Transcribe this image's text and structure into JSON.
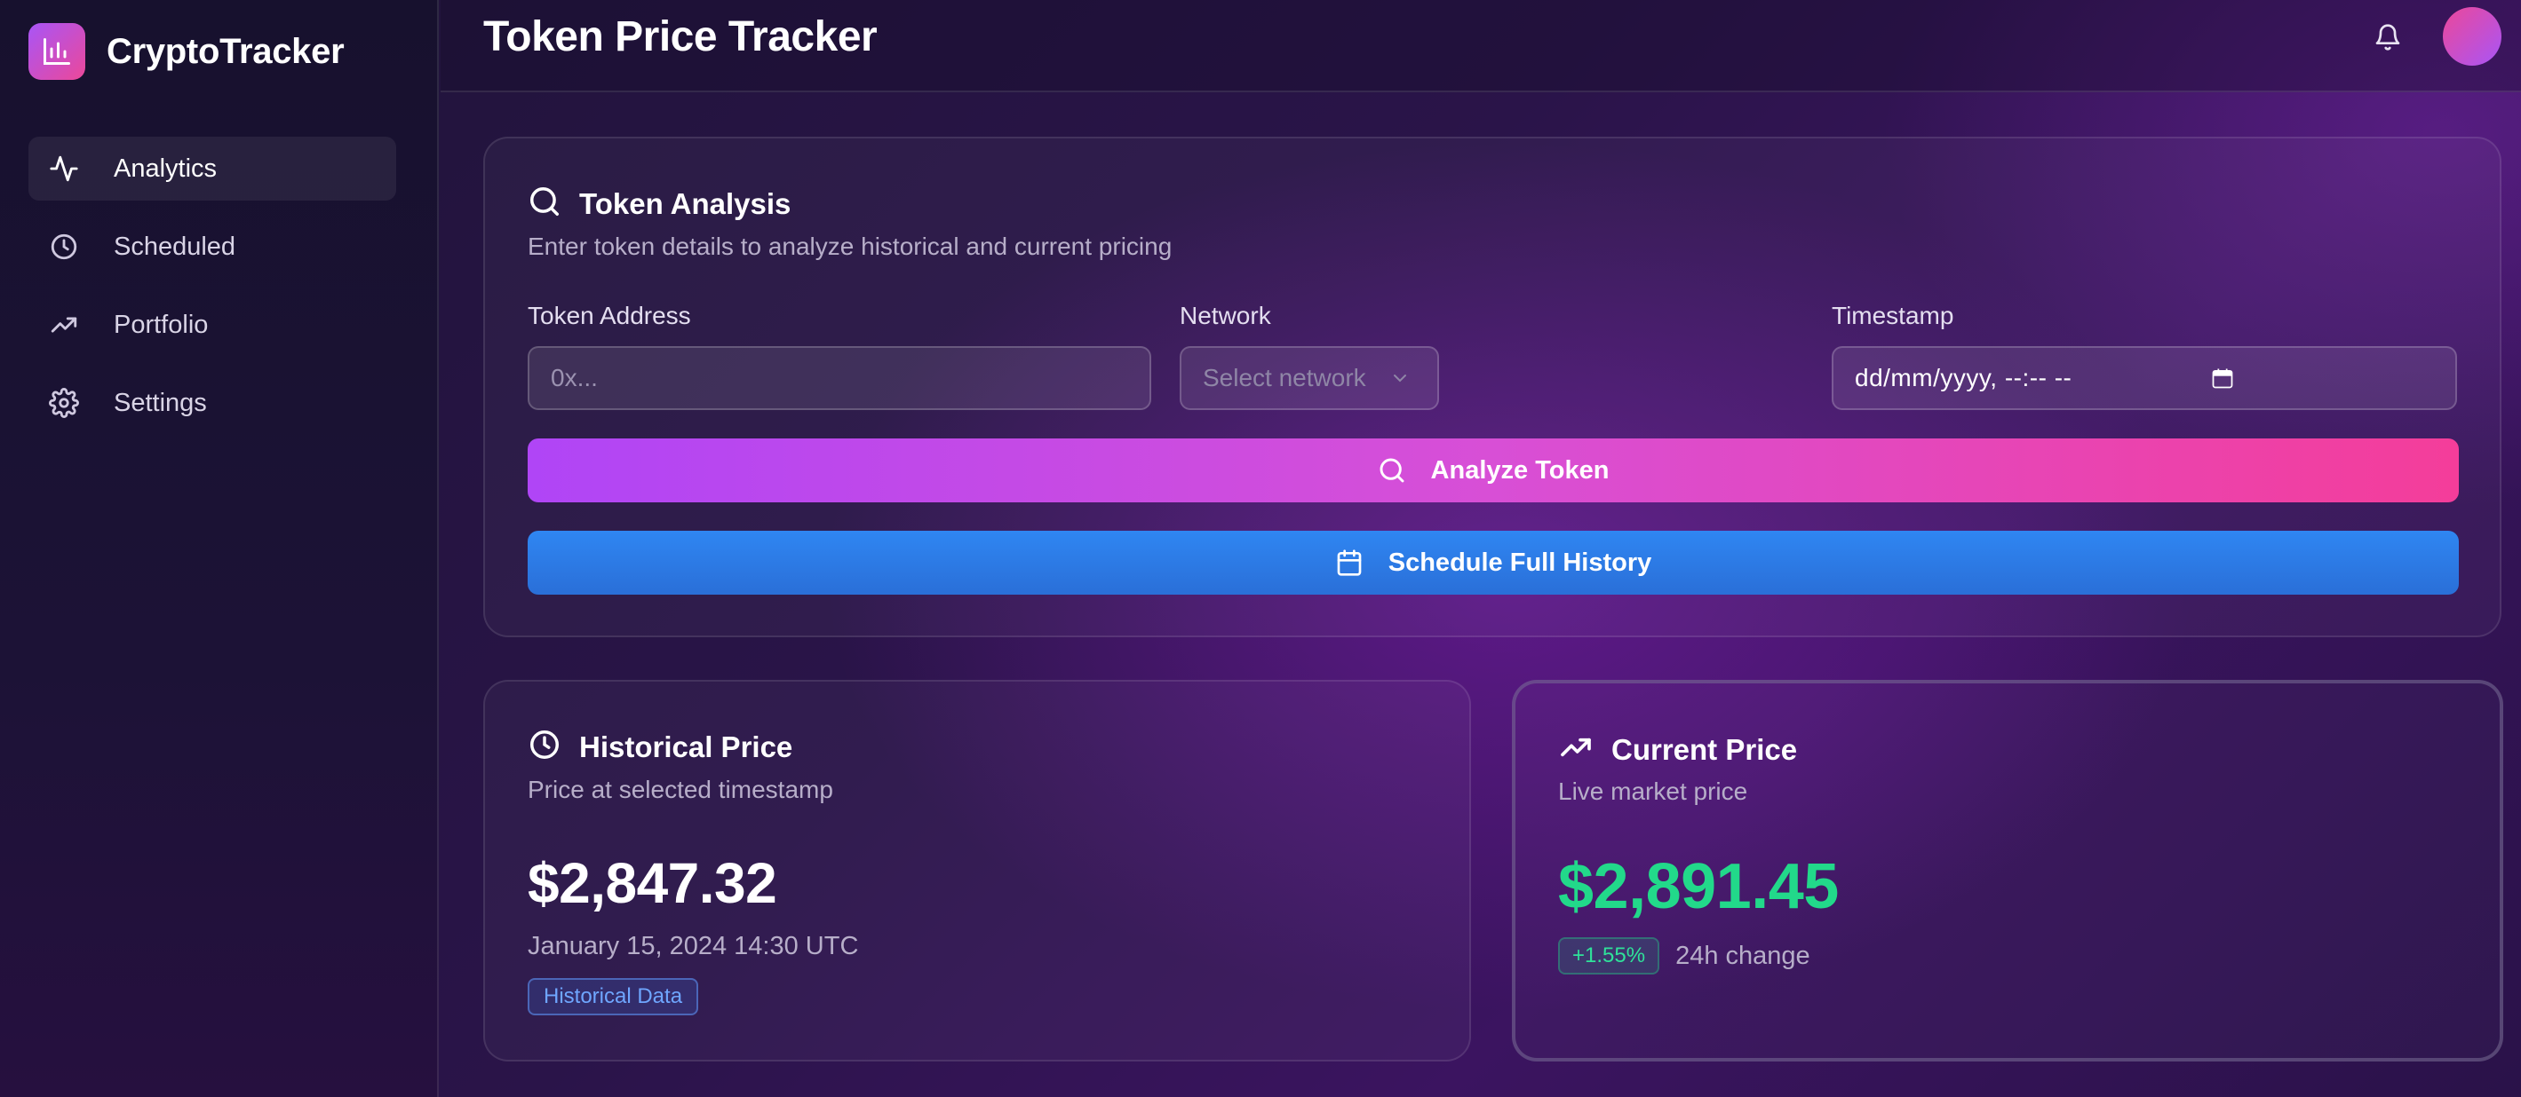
{
  "app": {
    "name": "CryptoTracker",
    "logo_icon": "bar-chart-icon",
    "colors": {
      "brand_gradient": [
        "#a855f7",
        "#ec4899"
      ],
      "analyze_button": [
        "#b045f6",
        "#f43d9a"
      ],
      "schedule_button": "#2f86f2",
      "positive": "#22d98a",
      "historical_badge": "#6fa6ff"
    }
  },
  "sidebar": {
    "items": [
      {
        "label": "Analytics",
        "icon": "activity-icon",
        "active": true
      },
      {
        "label": "Scheduled",
        "icon": "clock-icon",
        "active": false
      },
      {
        "label": "Portfolio",
        "icon": "trending-up-icon",
        "active": false
      },
      {
        "label": "Settings",
        "icon": "gear-icon",
        "active": false
      }
    ]
  },
  "header": {
    "title": "Token Price Tracker",
    "notifications_icon": "bell-icon"
  },
  "analysis": {
    "title": "Token Analysis",
    "subtitle": "Enter token details to analyze historical and current pricing",
    "token_address": {
      "label": "Token Address",
      "placeholder": "0x...",
      "value": ""
    },
    "network": {
      "label": "Network",
      "placeholder": "Select network"
    },
    "timestamp": {
      "label": "Timestamp",
      "display": "dd/mm/yyyy, --:-- --"
    },
    "analyze_label": "Analyze Token",
    "schedule_label": "Schedule Full History"
  },
  "historical": {
    "title": "Historical Price",
    "subtitle": "Price at selected timestamp",
    "price": "$2,847.32",
    "date": "January 15, 2024 14:30 UTC",
    "badge": "Historical Data"
  },
  "current": {
    "title": "Current Price",
    "subtitle": "Live market price",
    "price": "$2,891.45",
    "change": "+1.55%",
    "change_label": "24h change"
  }
}
